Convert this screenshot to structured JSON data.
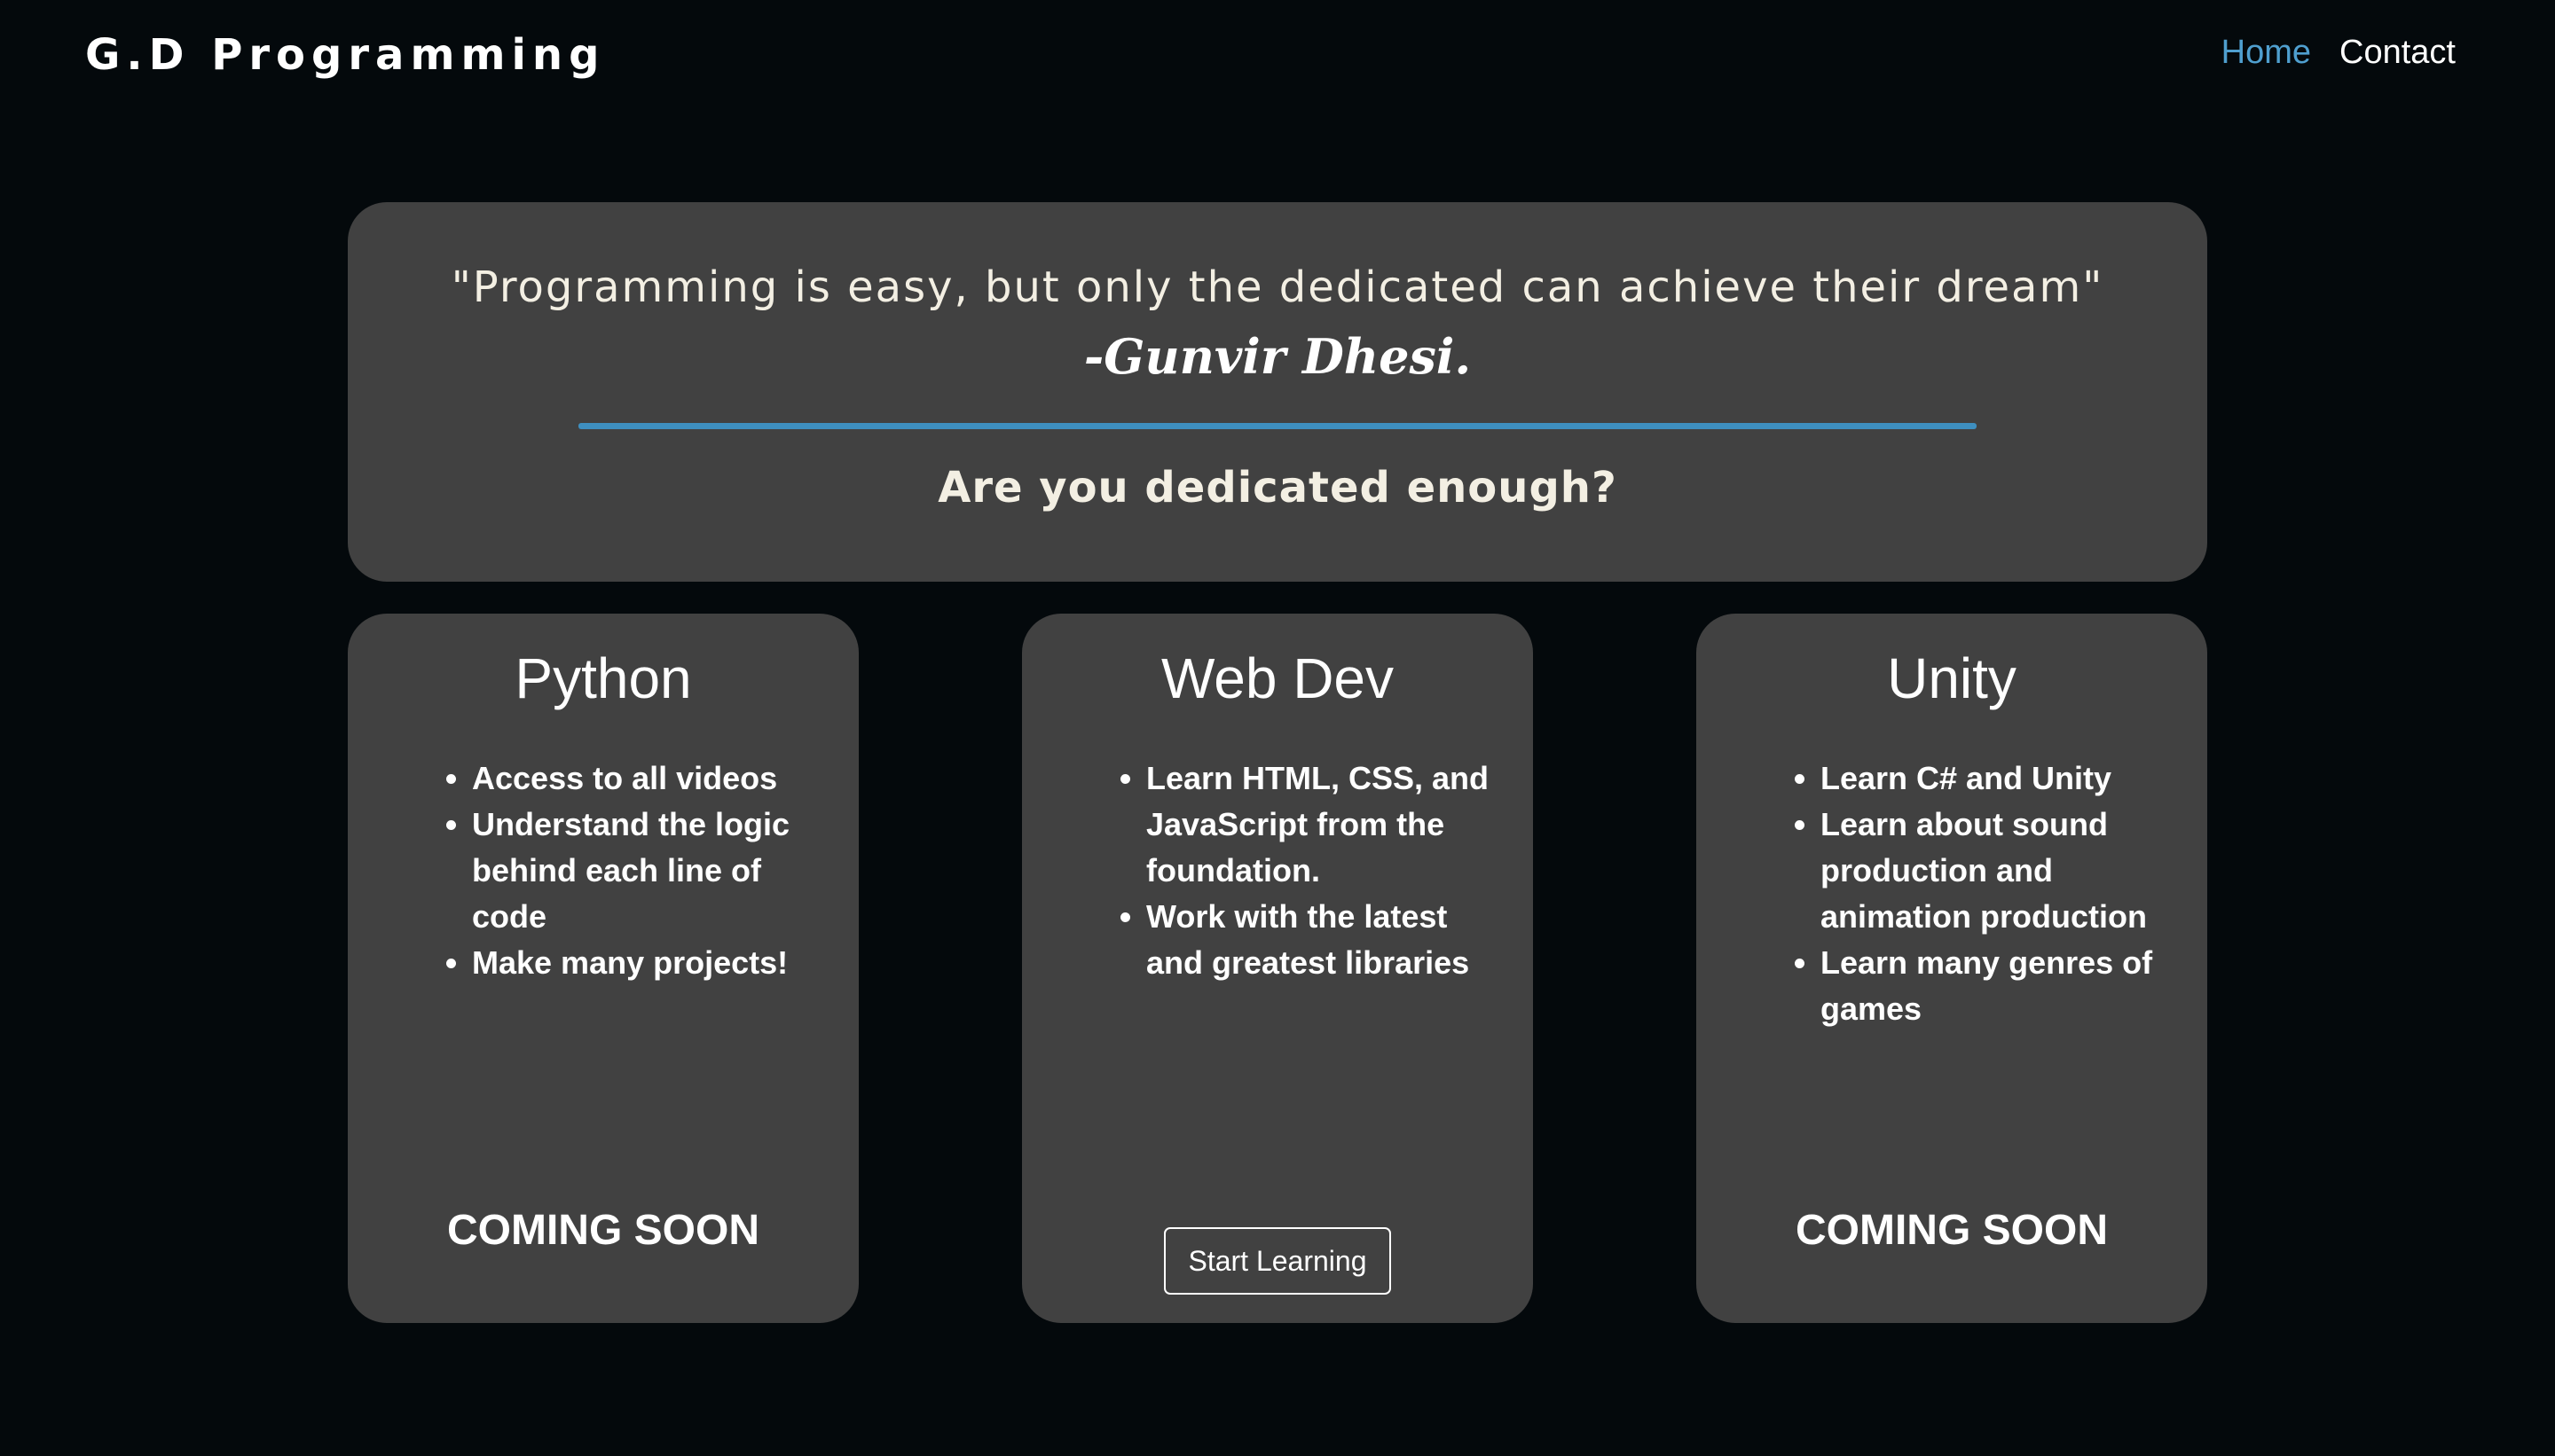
{
  "nav": {
    "brand": "G.D Programming",
    "links": [
      {
        "label": "Home",
        "active": true
      },
      {
        "label": "Contact",
        "active": false
      }
    ]
  },
  "hero": {
    "quote": "\"Programming is easy, but only the dedicated can achieve their dream\"",
    "author": "-Gunvir Dhesi.",
    "question": "Are you dedicated enough?"
  },
  "cards": [
    {
      "title": "Python",
      "items": [
        "Access to all videos",
        "Understand the logic behind each line of code",
        "Make many projects!"
      ],
      "footer": "COMING SOON"
    },
    {
      "title": "Web Dev",
      "items": [
        "Learn HTML, CSS, and JavaScript from the foundation.",
        "Work with the latest and greatest libraries"
      ],
      "button": "Start Learning"
    },
    {
      "title": "Unity",
      "items": [
        "Learn C# and Unity",
        "Learn about sound production and animation production",
        "Learn many genres of games"
      ],
      "footer": "COMING SOON"
    }
  ],
  "colors": {
    "background": "#04090c",
    "panel": "#414141",
    "accent": "#4f9fcf",
    "divider": "#3e8fc0",
    "quote_text": "#f3efe3"
  }
}
